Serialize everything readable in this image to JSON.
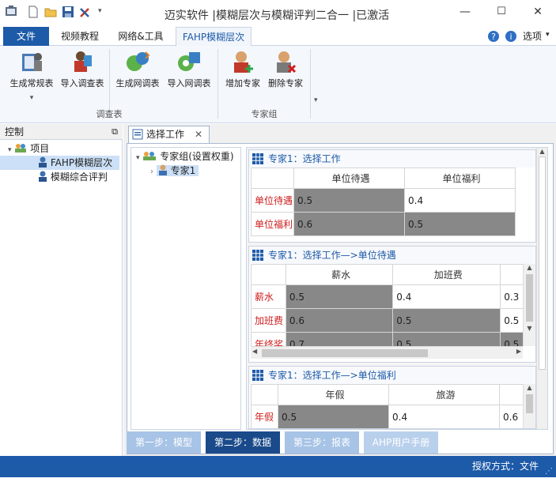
{
  "window": {
    "title": "迈实软件 |模糊层次与模糊评判二合一 |已激活",
    "min": "—",
    "max": "☐",
    "close": "✕"
  },
  "menu": {
    "file": "文件",
    "tabs": [
      "视频教程",
      "网络&工具",
      "FAHP模糊层次"
    ],
    "options": "选项"
  },
  "ribbon": {
    "buttons": [
      {
        "label": "生成常规表",
        "icon": "form-icon"
      },
      {
        "label": "导入调查表",
        "icon": "import-icon"
      },
      {
        "label": "生成网调表",
        "icon": "web-form-icon"
      },
      {
        "label": "导入网调表",
        "icon": "web-import-icon"
      },
      {
        "label": "增加专家",
        "icon": "add-user-icon"
      },
      {
        "label": "删除专家",
        "icon": "remove-user-icon"
      }
    ],
    "groups": [
      "调查表",
      "专家组"
    ]
  },
  "control": {
    "title": "控制",
    "tree": {
      "root": "项目",
      "children": [
        "FAHP模糊层次",
        "模糊综合评判"
      ]
    }
  },
  "document": {
    "tab": "选择工作",
    "expert_tree": {
      "root": "专家组(设置权重)",
      "child": "专家1"
    },
    "matrices": [
      {
        "title": "专家1：选择工作",
        "cols": [
          "单位待遇",
          "单位福利"
        ],
        "rows": [
          {
            "label": "单位待遇",
            "cells": [
              "0.5",
              "0.4"
            ]
          },
          {
            "label": "单位福利",
            "cells": [
              "0.6",
              "0.5"
            ]
          }
        ]
      },
      {
        "title": "专家1：选择工作—>单位待遇",
        "cols": [
          "薪水",
          "加班费"
        ],
        "rows": [
          {
            "label": "薪水",
            "cells": [
              "0.5",
              "0.4",
              "0.3"
            ]
          },
          {
            "label": "加班费",
            "cells": [
              "0.6",
              "0.5",
              "0.5"
            ]
          },
          {
            "label": "年终奖",
            "cells": [
              "0.7",
              "0.5",
              "0.5"
            ]
          }
        ]
      },
      {
        "title": "专家1：选择工作—>单位福利",
        "cols": [
          "年假",
          "旅游"
        ],
        "rows": [
          {
            "label": "年假",
            "cells": [
              "0.5",
              "0.4",
              "0.6"
            ]
          }
        ]
      }
    ]
  },
  "steps": [
    "第一步：模型",
    "第二步：数据",
    "第三步：报表",
    "AHP用户手册"
  ],
  "status": {
    "license": "授权方式：文件"
  },
  "colors": {
    "accent": "#1d5aa8",
    "dark_step": "#1a4a8a",
    "row_header": "#d01e1e",
    "gray_cell": "#888888"
  }
}
